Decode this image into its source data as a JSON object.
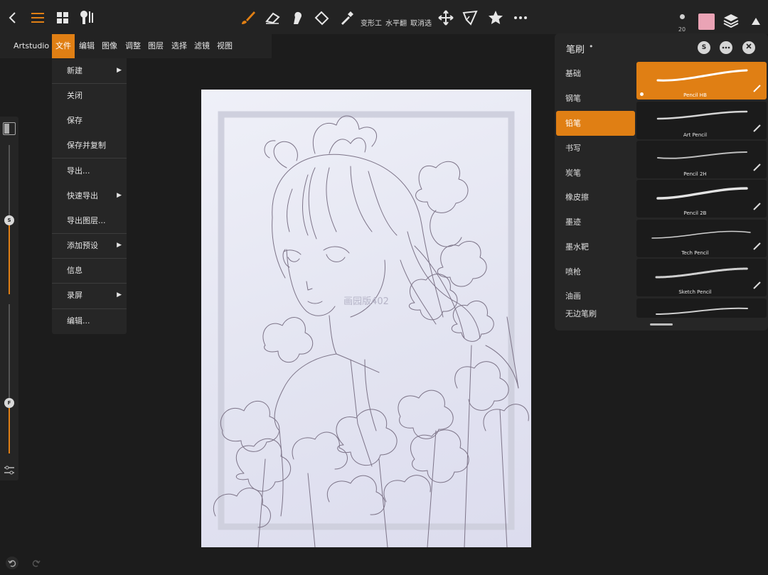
{
  "toolbar": {
    "transform_label": "变形工",
    "flip_label": "水平翻",
    "deselect_label": "取消选",
    "brush_size": "20",
    "color": "#eaa3b5",
    "accent": "#e07f14",
    "icons": [
      "back-icon",
      "menu-icon",
      "gallery-icon",
      "brush-settings-icon",
      "brush-icon",
      "eraser-icon",
      "smudge-icon",
      "fill-icon",
      "eyedropper-icon",
      "move-icon",
      "selection-icon",
      "star-icon",
      "more-icon",
      "layers-icon",
      "collapse-icon"
    ]
  },
  "menubar": {
    "items": [
      "Artstudio",
      "文件",
      "编辑",
      "图像",
      "调整",
      "图层",
      "选择",
      "滤镜",
      "视图"
    ],
    "active_index": 1
  },
  "file_menu": {
    "items": [
      {
        "label": "新建",
        "submenu": true
      },
      {
        "label": "关闭",
        "submenu": false
      },
      {
        "label": "保存",
        "submenu": false
      },
      {
        "label": "保存并复制",
        "submenu": false
      },
      {
        "label": "导出...",
        "submenu": false
      },
      {
        "label": "快速导出",
        "submenu": true
      },
      {
        "label": "导出图层...",
        "submenu": false
      },
      {
        "label": "添加预设",
        "submenu": true
      },
      {
        "label": "信息",
        "submenu": false
      },
      {
        "label": "录屏",
        "submenu": true
      },
      {
        "label": "编辑...",
        "submenu": false
      }
    ]
  },
  "side_sliders": {
    "size_label": "S",
    "size_value": 0.5,
    "opacity_label": "F",
    "opacity_value": 0.3
  },
  "brush_panel": {
    "title": "笔刷",
    "title_dot": "•",
    "s_button": "S",
    "categories": [
      "基础",
      "钢笔",
      "铅笔",
      "书写",
      "炭笔",
      "橡皮擦",
      "墨迹",
      "墨水靶",
      "喷枪",
      "油画",
      "无边笔刷"
    ],
    "active_category": 2,
    "brushes": [
      "Pencil HB",
      "Art Pencil",
      "Pencil 2H",
      "Pencil 2B",
      "Tech Pencil",
      "Sketch Pencil"
    ],
    "active_brush": 0
  },
  "canvas": {
    "watermark": "画园版402"
  }
}
